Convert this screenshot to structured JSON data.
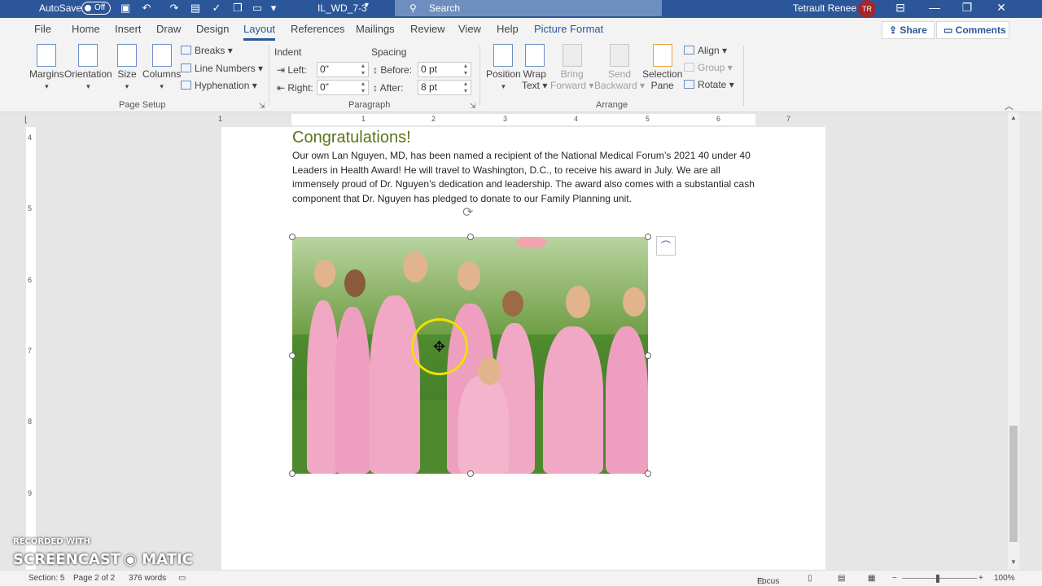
{
  "titlebar": {
    "autosave_label": "AutoSave",
    "autosave_state": "Off",
    "doc_name": "IL_WD_7-3",
    "search_placeholder": "Search",
    "user_name": "Tetrault Renee",
    "user_initials": "TR"
  },
  "tabs": [
    "File",
    "Home",
    "Insert",
    "Draw",
    "Design",
    "Layout",
    "References",
    "Mailings",
    "Review",
    "View",
    "Help",
    "Picture Format"
  ],
  "active_tab": "Layout",
  "share_label": "Share",
  "comments_label": "Comments",
  "ribbon": {
    "page_setup": {
      "margins": "Margins",
      "orientation": "Orientation",
      "size": "Size",
      "columns": "Columns",
      "breaks": "Breaks",
      "line_numbers": "Line Numbers",
      "hyphenation": "Hyphenation",
      "group_label": "Page Setup"
    },
    "paragraph": {
      "indent_label": "Indent",
      "spacing_label": "Spacing",
      "left_label": "Left:",
      "left_value": "0\"",
      "right_label": "Right:",
      "right_value": "0\"",
      "before_label": "Before:",
      "before_value": "0 pt",
      "after_label": "After:",
      "after_value": "8 pt",
      "group_label": "Paragraph"
    },
    "arrange": {
      "position": "Position",
      "wrap_text_1": "Wrap",
      "wrap_text_2": "Text",
      "bring_forward_1": "Bring",
      "bring_forward_2": "Forward",
      "send_backward_1": "Send",
      "send_backward_2": "Backward",
      "selection_pane_1": "Selection",
      "selection_pane_2": "Pane",
      "align": "Align",
      "group": "Group",
      "rotate": "Rotate",
      "group_label": "Arrange"
    }
  },
  "ruler": {
    "h_numbers": [
      "1",
      "1",
      "2",
      "3",
      "4",
      "5",
      "6",
      "7"
    ],
    "v_numbers": [
      "4",
      "5",
      "6",
      "7",
      "8",
      "9"
    ]
  },
  "document": {
    "heading": "Congratulations!",
    "body": "Our own Lan Nguyen, MD, has been named a recipient of the National Medical Forum’s 2021 40 under 40 Leaders in Health Award! He will travel to Washington, D.C., to receive his award in July. We are all immensely proud of Dr. Nguyen’s dedication and leadership. The award also comes with a substantial cash component that Dr. Nguyen has pledged to donate to our Family Planning unit."
  },
  "status": {
    "section": "Section: 5",
    "page": "Page 2 of 2",
    "words": "376 words",
    "focus": "Focus",
    "zoom": "100%"
  },
  "watermark": {
    "line1": "RECORDED WITH",
    "line2": "SCREENCAST",
    "line3": "MATIC"
  },
  "colors": {
    "accent": "#2b579a",
    "heading": "#5b7418"
  }
}
